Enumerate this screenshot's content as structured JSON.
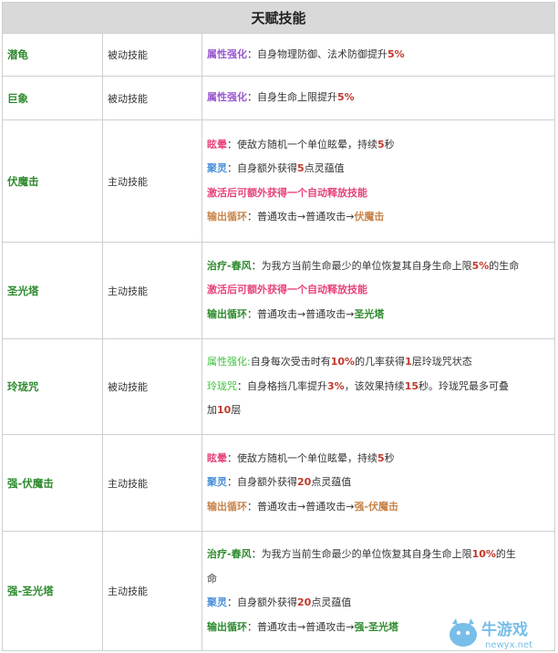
{
  "title": "天赋技能",
  "colors": {
    "name_green": "#2e8b2e",
    "purple": "#9b59d0",
    "pink": "#e7437c",
    "blue": "#4a90d9",
    "bright_green": "#3fc23f",
    "dark_green": "#2e8b2e",
    "orange": "#c8844a",
    "red_number": "#c0392b"
  },
  "rows": [
    {
      "name": "潜龟",
      "type": "被动技能",
      "height": 47,
      "lines": [
        [
          {
            "t": "属性强化",
            "c": "purple",
            "b": true
          },
          {
            "t": "：自身物理防御、法术防御提升"
          },
          {
            "t": "5%",
            "c": "red_number",
            "b": true
          }
        ]
      ]
    },
    {
      "name": "巨象",
      "type": "被动技能",
      "height": 48,
      "lines": [
        [
          {
            "t": "属性强化",
            "c": "purple",
            "b": true
          },
          {
            "t": "：自身生命上限提升"
          },
          {
            "t": "5%",
            "c": "red_number",
            "b": true
          }
        ]
      ]
    },
    {
      "name": "伏魔击",
      "type": "主动技能",
      "height": 134,
      "lines": [
        [
          {
            "t": "眩晕",
            "c": "pink",
            "b": true
          },
          {
            "t": "：使敌方随机一个单位眩晕，持续"
          },
          {
            "t": "5",
            "c": "red_number",
            "b": true
          },
          {
            "t": "秒"
          }
        ],
        [
          {
            "t": "聚灵",
            "c": "blue",
            "b": true
          },
          {
            "t": "：自身额外获得"
          },
          {
            "t": "5",
            "c": "red_number",
            "b": true
          },
          {
            "t": "点灵蕴值"
          }
        ],
        [
          {
            "t": "激活后可额外获得一个自动释放技能",
            "c": "pink",
            "b": true
          }
        ],
        [
          {
            "t": "输出循环",
            "c": "orange",
            "b": true
          },
          {
            "t": "：普通攻击→普通攻击→"
          },
          {
            "t": "伏魔击",
            "c": "orange",
            "b": true
          }
        ]
      ]
    },
    {
      "name": "圣光塔",
      "type": "主动技能",
      "height": 106,
      "lines": [
        [
          {
            "t": "治疗-春风",
            "c": "dark_green",
            "b": true
          },
          {
            "t": "：为我方当前生命最少的单位恢复其自身生命上限"
          },
          {
            "t": "5%",
            "c": "red_number",
            "b": true
          },
          {
            "t": "的生命"
          }
        ],
        [
          {
            "t": "激活后可额外获得一个自动释放技能",
            "c": "pink",
            "b": true
          }
        ],
        [
          {
            "t": "输出循环",
            "c": "dark_green",
            "b": true
          },
          {
            "t": "：普通攻击→普通攻击→"
          },
          {
            "t": "圣光塔",
            "c": "dark_green",
            "b": true
          }
        ]
      ]
    },
    {
      "name": "玲珑咒",
      "type": "被动技能",
      "height": 105,
      "lines": [
        [
          {
            "t": "属性强化:",
            "c": "bright_green"
          },
          {
            "t": "自身每次受击时有"
          },
          {
            "t": "10%",
            "c": "red_number",
            "b": true
          },
          {
            "t": "的几率获得"
          },
          {
            "t": "1",
            "c": "red_number",
            "b": true
          },
          {
            "t": "层玲珑咒状态"
          }
        ],
        [
          {
            "t": "玲珑咒",
            "c": "bright_green"
          },
          {
            "t": "：自身格挡几率提升"
          },
          {
            "t": "3%",
            "c": "red_number",
            "b": true
          },
          {
            "t": "，该效果持续"
          },
          {
            "t": "15",
            "c": "red_number",
            "b": true
          },
          {
            "t": "秒。玲珑咒最多可叠"
          }
        ],
        [
          {
            "t": "加"
          },
          {
            "t": "10",
            "c": "red_number",
            "b": true
          },
          {
            "t": "层"
          }
        ]
      ]
    },
    {
      "name": "强-伏魔击",
      "type": "主动技能",
      "height": 106,
      "lines": [
        [
          {
            "t": "眩晕",
            "c": "pink",
            "b": true
          },
          {
            "t": "：使敌方随机一个单位眩晕，持续"
          },
          {
            "t": "5",
            "c": "red_number",
            "b": true
          },
          {
            "t": "秒"
          }
        ],
        [
          {
            "t": "聚灵",
            "c": "blue",
            "b": true
          },
          {
            "t": "：自身额外获得"
          },
          {
            "t": "20",
            "c": "red_number",
            "b": true
          },
          {
            "t": "点灵蕴值"
          }
        ],
        [
          {
            "t": "输出循环",
            "c": "orange",
            "b": true
          },
          {
            "t": "：普通攻击→普通攻击→"
          },
          {
            "t": "强-伏魔击",
            "c": "orange",
            "b": true
          }
        ]
      ]
    },
    {
      "name": "强-圣光塔",
      "type": "主动技能",
      "height": 131,
      "lines": [
        [
          {
            "t": "治疗-春风",
            "c": "dark_green",
            "b": true
          },
          {
            "t": "：为我方当前生命最少的单位恢复其自身生命上限"
          },
          {
            "t": "10%",
            "c": "red_number",
            "b": true
          },
          {
            "t": "的生"
          }
        ],
        [
          {
            "t": "命"
          }
        ],
        [
          {
            "t": "聚灵",
            "c": "blue",
            "b": true
          },
          {
            "t": "：自身额外获得"
          },
          {
            "t": "20",
            "c": "red_number",
            "b": true
          },
          {
            "t": "点灵蕴值"
          }
        ],
        [
          {
            "t": "输出循环",
            "c": "dark_green",
            "b": true
          },
          {
            "t": "：普通攻击→普通攻击→"
          },
          {
            "t": "强-圣光塔",
            "c": "dark_green",
            "b": true
          }
        ]
      ]
    }
  ],
  "watermark": {
    "text_main": "牛游戏",
    "text_sub": "newyx.net"
  }
}
